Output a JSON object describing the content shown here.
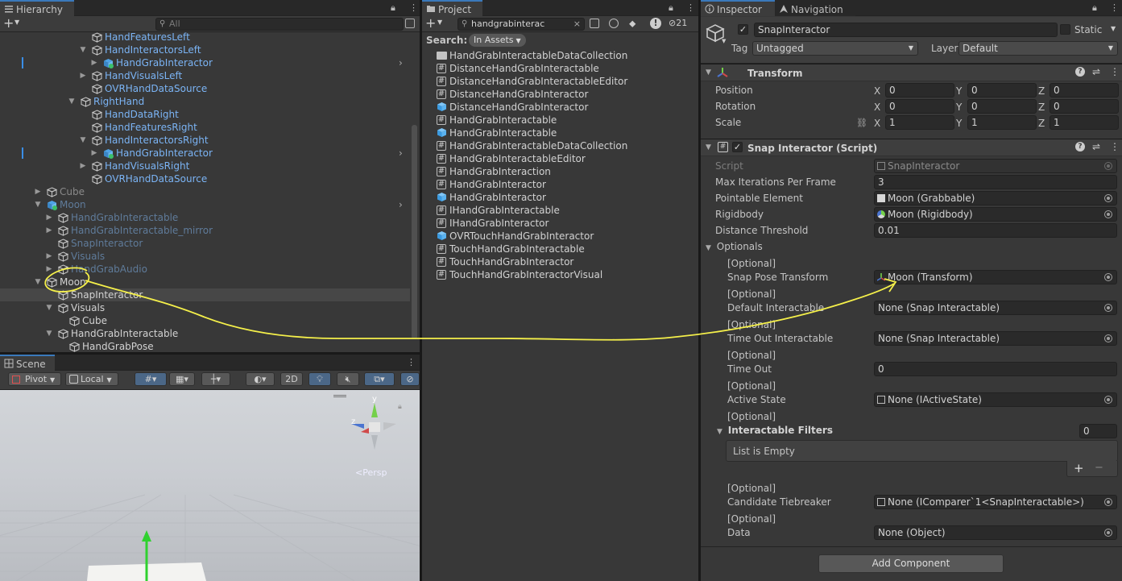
{
  "hierarchy": {
    "tab_label": "Hierarchy",
    "search_placeholder": "All",
    "rows": [
      {
        "label": "HandFeaturesLeft",
        "style": "blue",
        "indent": 115,
        "arrow": false,
        "icon": "cube"
      },
      {
        "label": "HandInteractorsLeft",
        "style": "blue",
        "indent": 115,
        "arrow": true,
        "icon": "cube"
      },
      {
        "label": "HandGrabInteractor",
        "style": "blue",
        "indent": 129,
        "arrow": true,
        "icon": "prefab-cube",
        "chevron": true,
        "marker": true
      },
      {
        "label": "HandVisualsLeft",
        "style": "blue",
        "indent": 115,
        "arrow": true,
        "icon": "cube"
      },
      {
        "label": "OVRHandDataSource",
        "style": "blue",
        "indent": 115,
        "arrow": false,
        "icon": "cube"
      },
      {
        "label": "RightHand",
        "style": "blue",
        "indent": 101,
        "arrow": true,
        "icon": "cube"
      },
      {
        "label": "HandDataRight",
        "style": "blue",
        "indent": 115,
        "arrow": false,
        "icon": "cube"
      },
      {
        "label": "HandFeaturesRight",
        "style": "blue",
        "indent": 115,
        "arrow": false,
        "icon": "cube"
      },
      {
        "label": "HandInteractorsRight",
        "style": "blue",
        "indent": 115,
        "arrow": true,
        "icon": "cube"
      },
      {
        "label": "HandGrabInteractor",
        "style": "blue",
        "indent": 129,
        "arrow": true,
        "icon": "prefab-cube",
        "chevron": true,
        "marker": true
      },
      {
        "label": "HandVisualsRight",
        "style": "blue",
        "indent": 115,
        "arrow": true,
        "icon": "cube"
      },
      {
        "label": "OVRHandDataSource",
        "style": "blue",
        "indent": 115,
        "arrow": false,
        "icon": "cube"
      },
      {
        "label": "Cube",
        "style": "gray",
        "indent": 59,
        "arrow": true,
        "icon": "cube"
      },
      {
        "label": "Moon",
        "style": "dim",
        "indent": 59,
        "arrow": true,
        "icon": "prefab-cube",
        "chevron": true,
        "expanded": true
      },
      {
        "label": "HandGrabInteractable",
        "style": "dim",
        "indent": 73,
        "arrow": true,
        "icon": "cube"
      },
      {
        "label": "HandGrabInteractable_mirror",
        "style": "dim",
        "indent": 73,
        "arrow": true,
        "icon": "cube"
      },
      {
        "label": "SnapInteractor",
        "style": "dim",
        "indent": 73,
        "arrow": false,
        "icon": "cube"
      },
      {
        "label": "Visuals",
        "style": "dim",
        "indent": 73,
        "arrow": true,
        "icon": "cube"
      },
      {
        "label": "HandGrabAudio",
        "style": "dim",
        "indent": 73,
        "arrow": true,
        "icon": "cube"
      },
      {
        "label": "Moon",
        "style": "white",
        "indent": 59,
        "arrow": true,
        "icon": "cube",
        "expanded": true
      },
      {
        "label": "SnapInteractor",
        "style": "white",
        "indent": 73,
        "arrow": false,
        "icon": "cube",
        "selected": true
      },
      {
        "label": "Visuals",
        "style": "white",
        "indent": 73,
        "arrow": true,
        "icon": "cube",
        "expanded": true
      },
      {
        "label": "Cube",
        "style": "white",
        "indent": 87,
        "arrow": false,
        "icon": "cube"
      },
      {
        "label": "HandGrabInteractable",
        "style": "white",
        "indent": 73,
        "arrow": true,
        "icon": "cube",
        "expanded": true
      },
      {
        "label": "HandGrabPose",
        "style": "white",
        "indent": 87,
        "arrow": false,
        "icon": "cube"
      }
    ]
  },
  "scene": {
    "tab_label": "Scene",
    "pivot_label": "Pivot",
    "local_label": "Local",
    "mode_2d": "2D",
    "gizmo_label": "Persp",
    "gizmo_y": "y",
    "gizmo_z": "z"
  },
  "project": {
    "tab_label": "Project",
    "search_value": "handgrabinterac",
    "hidden_count": "21",
    "search_label": "Search:",
    "search_scope": "In Assets",
    "items": [
      {
        "label": "HandGrabInteractableDataCollection",
        "icon": "folder"
      },
      {
        "label": "DistanceHandGrabInteractable",
        "icon": "script"
      },
      {
        "label": "DistanceHandGrabInteractableEditor",
        "icon": "script"
      },
      {
        "label": "DistanceHandGrabInteractor",
        "icon": "script"
      },
      {
        "label": "DistanceHandGrabInteractor",
        "icon": "prefab"
      },
      {
        "label": "HandGrabInteractable",
        "icon": "script"
      },
      {
        "label": "HandGrabInteractable",
        "icon": "prefab"
      },
      {
        "label": "HandGrabInteractableDataCollection",
        "icon": "script"
      },
      {
        "label": "HandGrabInteractableEditor",
        "icon": "script"
      },
      {
        "label": "HandGrabInteraction",
        "icon": "script"
      },
      {
        "label": "HandGrabInteractor",
        "icon": "script"
      },
      {
        "label": "HandGrabInteractor",
        "icon": "prefab"
      },
      {
        "label": "IHandGrabInteractable",
        "icon": "script"
      },
      {
        "label": "IHandGrabInteractor",
        "icon": "script"
      },
      {
        "label": "OVRTouchHandGrabInteractor",
        "icon": "prefab"
      },
      {
        "label": "TouchHandGrabInteractable",
        "icon": "script"
      },
      {
        "label": "TouchHandGrabInteractor",
        "icon": "script"
      },
      {
        "label": "TouchHandGrabInteractorVisual",
        "icon": "script"
      }
    ]
  },
  "inspector": {
    "tab_label": "Inspector",
    "nav_tab_label": "Navigation",
    "object_name": "SnapInteractor",
    "static_label": "Static",
    "tag_label": "Tag",
    "tag_value": "Untagged",
    "layer_label": "Layer",
    "layer_value": "Default",
    "transform": {
      "title": "Transform",
      "rows": [
        {
          "label": "Position",
          "x": "0",
          "y": "0",
          "z": "0"
        },
        {
          "label": "Rotation",
          "x": "0",
          "y": "0",
          "z": "0"
        },
        {
          "label": "Scale",
          "x": "1",
          "y": "1",
          "z": "1"
        }
      ],
      "axis_x": "X",
      "axis_y": "Y",
      "axis_z": "Z"
    },
    "snap": {
      "title": "Snap Interactor (Script)",
      "script_label": "Script",
      "script_value": "SnapInteractor",
      "max_iter_label": "Max Iterations Per Frame",
      "max_iter_value": "3",
      "pointable_label": "Pointable Element",
      "pointable_value": "Moon (Grabbable)",
      "rigidbody_label": "Rigidbody",
      "rigidbody_value": "Moon (Rigidbody)",
      "distance_label": "Distance Threshold",
      "distance_value": "0.01",
      "optionals_label": "Optionals",
      "optional_tag": "[Optional]",
      "snap_pose_label": "Snap Pose Transform",
      "snap_pose_value": "Moon (Transform)",
      "default_label": "Default Interactable",
      "default_value": "None (Snap Interactable)",
      "timeout_inter_label": "Time Out Interactable",
      "timeout_inter_value": "None (Snap Interactable)",
      "timeout_label": "Time Out",
      "timeout_value": "0",
      "active_label": "Active State",
      "active_value": "None (IActiveState)",
      "filters_label": "Interactable Filters",
      "filters_count": "0",
      "list_empty": "List is Empty",
      "plus": "+",
      "minus": "−",
      "tiebreaker_label": "Candidate Tiebreaker",
      "tiebreaker_value": "None (IComparer`1<SnapInteractable>)",
      "data_label": "Data",
      "data_value": "None (Object)"
    },
    "add_component": "Add Component"
  },
  "colors": {
    "accent": "#3a79bb",
    "annotation": "#f5f04a"
  }
}
